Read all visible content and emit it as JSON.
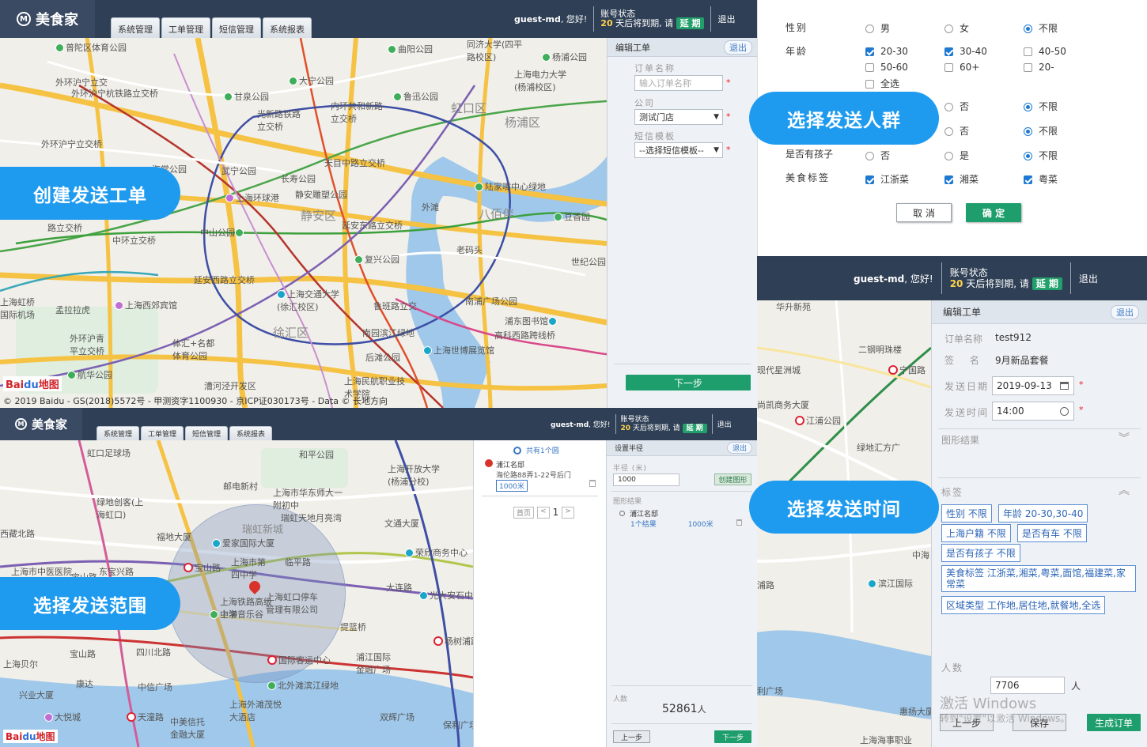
{
  "brand": {
    "name": "美食家",
    "mark": "M"
  },
  "nav": {
    "tabs": [
      "系统管理",
      "工单管理",
      "短信管理",
      "系统报表"
    ],
    "user": "guest-md",
    "greeting": "您好!",
    "account_status": "账号状态",
    "days": "20",
    "expire_text": "天后将到期, 请",
    "extend": "延 期",
    "logout": "退出"
  },
  "banners": {
    "create": "创建发送工单",
    "crowd": "选择发送人群",
    "range": "选择发送范围",
    "time": "选择发送时间"
  },
  "panel_create": {
    "title": "编辑工单",
    "exit": "退出",
    "order_label": "订单名称",
    "order_placeholder": "输入订单名称",
    "company_label": "公司",
    "company_value": "测试门店",
    "template_label": "短信模板",
    "template_value": "--选择短信模板--",
    "next": "下一步",
    "copyright": "© 2019 Baidu - GS(2018)5572号 - 甲测资字1100930 - 京ICP证030173号 - Data © 长地方向"
  },
  "map1_labels": [
    "普陀区体育公园",
    "曲阳公园",
    "同济大学(四平路校区)",
    "杨浦公园",
    "外环沪宁立交",
    "外环沪宁杭铁路立交桥",
    "大宁公园",
    "上海电力大学(杨浦校区)",
    "甘泉公园",
    "光新路铁路立交桥",
    "内环共和新路立交桥",
    "鲁迅公园",
    "虹口区",
    "杨浦区",
    "外环沪宁立交桥",
    "天目中路立交桥",
    "海棠公园",
    "武宁公园",
    "长寿公园",
    "陆家嘴中心绿地",
    "上海环球港",
    "静安雕塑公园",
    "外滩",
    "静安区",
    "八佰伴",
    "豆香园",
    "路立交桥",
    "中环立交桥",
    "延安东路立交桥",
    "中山公园",
    "世纪公园",
    "老码头",
    "复兴公园",
    "延安西路立交桥",
    "上海交通大学(徐汇校区)",
    "南浦广场公园",
    "上海虹桥国际机场",
    "孟拉拉虎",
    "上海西郊宾馆",
    "鲁班路立交",
    "浦东图书馆",
    "徐汇区",
    "南园滨江绿地",
    "高科西路跨线桥",
    "外环沪青平立交桥",
    "体汇+名都体育公园",
    "后滩公园",
    "上海世博展览馆",
    "航华公园",
    "漕河泾开发区",
    "上海民航职业技术学院"
  ],
  "panel_filter": {
    "gender_label": "性别",
    "gender_options": [
      "男",
      "女",
      "不限"
    ],
    "age_label": "年龄",
    "age_options": [
      "20-30",
      "30-40",
      "40-50",
      "50-60",
      "60+",
      "20-",
      "全选"
    ],
    "row3": [
      "否",
      "不限"
    ],
    "row4": [
      "否",
      "不限"
    ],
    "kids_label": "是否有孩子",
    "kids_options": [
      "否",
      "是",
      "不限"
    ],
    "food_label": "美食标签",
    "food_options": [
      "江浙菜",
      "湘菜",
      "粤菜"
    ],
    "cancel": "取 消",
    "confirm": "确 定"
  },
  "panel_range": {
    "search_result": "共有1个圆",
    "item_name": "浦江名邸",
    "item_addr": "海伦路88弄1-22号后门",
    "item_radius": "1000米",
    "pager_first": "首页",
    "pager_prev": "<",
    "pager_page": "1",
    "pager_next": ">",
    "title": "设置半径",
    "exit": "退出",
    "radius_label": "半径 (米)",
    "radius_value": "1000",
    "create_shape": "创建图形",
    "result_label": "图形结果",
    "result_name": "浦江名邸",
    "result_count": "1个结果",
    "result_radius": "1000米",
    "people_label": "人数",
    "people_value": "52861",
    "people_unit": "人",
    "prev": "上一步",
    "next": "下一步"
  },
  "map3_labels": [
    "虹口足球场",
    "和平公园",
    "上海开放大学(杨浦分校)",
    "邮电新村",
    "上海市华东师大一附初中",
    "绿地创客(上海虹口)",
    "瑞虹天地月亮湾",
    "西藏北路",
    "福地大厦",
    "爱家国际大厦",
    "文通大厦",
    "瑞虹新城",
    "宝山路",
    "宝山路",
    "上海市第四中学",
    "临平路",
    "荣欣商务中心",
    "大连路",
    "上海市中医医院",
    "东宝兴路",
    "上海铁路高级中学",
    "上海虹口停车管理有限公司",
    "光大安石中心",
    "上海音乐谷",
    "提篮桥",
    "杨树浦路",
    "上海贝尔",
    "四川北路",
    "国际客运中心",
    "浦江国际金融广场",
    "宝山路",
    "康达",
    "中信广场",
    "北外滩滨江绿地",
    "兴业大厦",
    "上海外滩茂悦大酒店",
    "大悦城",
    "天潼路",
    "中美信托金融大厦",
    "双辉广场",
    "保利广场"
  ],
  "panel_time": {
    "title": "编辑工单",
    "exit": "退出",
    "order_label": "订单名称",
    "order_value": "test912",
    "sign_label": "签 名",
    "sign_value": "9月新品套餐",
    "date_label": "发送日期",
    "date_value": "2019-09-13",
    "time_label": "发送时间",
    "time_value": "14:00",
    "shape_label": "图形结果",
    "tags_label": "标签",
    "tags": [
      "性别 不限",
      "年龄 20-30,30-40",
      "上海户籍 不限",
      "是否有车 不限",
      "是否有孩子 不限",
      "美食标签 江浙菜,湘菜,粤菜,面馆,福建菜,家常菜",
      "区域类型 工作地,居住地,就餐地,全选"
    ],
    "people_label": "人数",
    "people_value": "7706",
    "people_unit": "人",
    "prev": "上一步",
    "save": "保存",
    "generate": "生成订单",
    "watermark": "激活 Windows",
    "watermark_sub": "转到\"设置\"以激活 Windows。"
  },
  "map4_labels": [
    "华升新苑",
    "二钢明珠楼",
    "宁国路",
    "现代星洲城",
    "尚凯商务大厦",
    "江浦公园",
    "绿地汇方广",
    "中海",
    "滨江国际",
    "浦路",
    "利广场",
    "惠扬大厦",
    "上海海事职业"
  ]
}
